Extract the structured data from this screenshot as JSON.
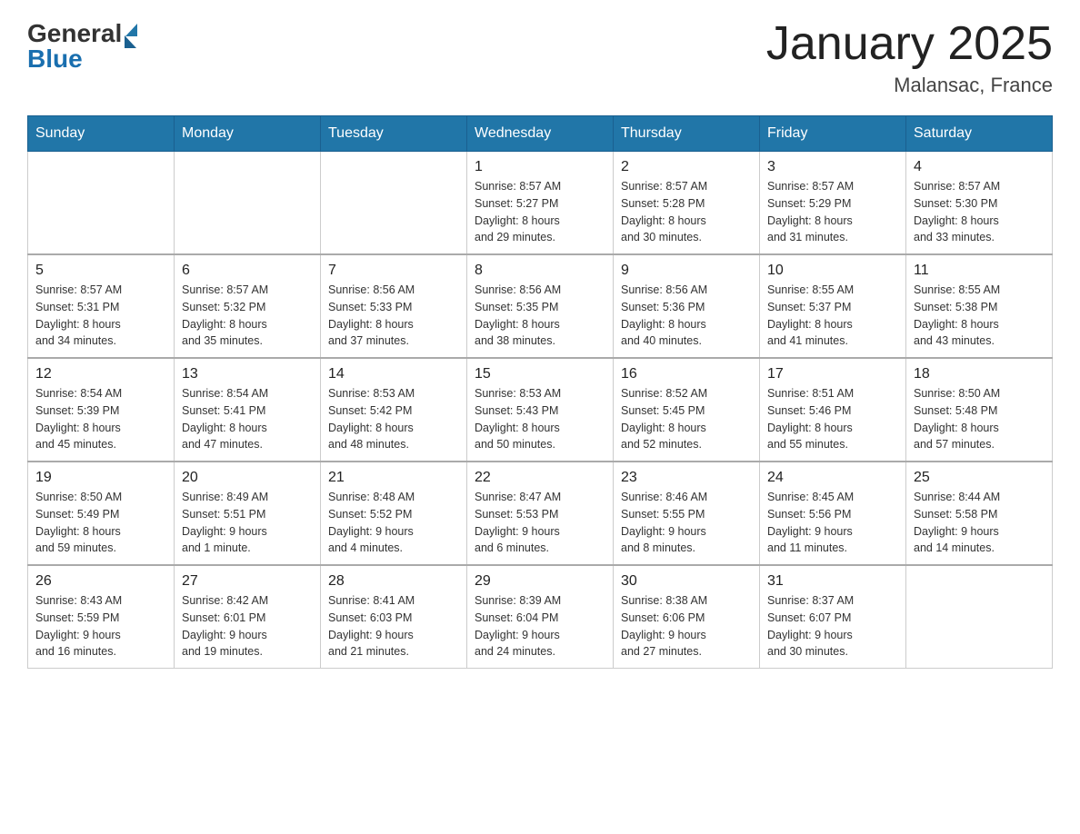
{
  "header": {
    "logo_general": "General",
    "logo_blue": "Blue",
    "title": "January 2025",
    "subtitle": "Malansac, France"
  },
  "days_of_week": [
    "Sunday",
    "Monday",
    "Tuesday",
    "Wednesday",
    "Thursday",
    "Friday",
    "Saturday"
  ],
  "weeks": [
    [
      {
        "day": "",
        "info": ""
      },
      {
        "day": "",
        "info": ""
      },
      {
        "day": "",
        "info": ""
      },
      {
        "day": "1",
        "info": "Sunrise: 8:57 AM\nSunset: 5:27 PM\nDaylight: 8 hours\nand 29 minutes."
      },
      {
        "day": "2",
        "info": "Sunrise: 8:57 AM\nSunset: 5:28 PM\nDaylight: 8 hours\nand 30 minutes."
      },
      {
        "day": "3",
        "info": "Sunrise: 8:57 AM\nSunset: 5:29 PM\nDaylight: 8 hours\nand 31 minutes."
      },
      {
        "day": "4",
        "info": "Sunrise: 8:57 AM\nSunset: 5:30 PM\nDaylight: 8 hours\nand 33 minutes."
      }
    ],
    [
      {
        "day": "5",
        "info": "Sunrise: 8:57 AM\nSunset: 5:31 PM\nDaylight: 8 hours\nand 34 minutes."
      },
      {
        "day": "6",
        "info": "Sunrise: 8:57 AM\nSunset: 5:32 PM\nDaylight: 8 hours\nand 35 minutes."
      },
      {
        "day": "7",
        "info": "Sunrise: 8:56 AM\nSunset: 5:33 PM\nDaylight: 8 hours\nand 37 minutes."
      },
      {
        "day": "8",
        "info": "Sunrise: 8:56 AM\nSunset: 5:35 PM\nDaylight: 8 hours\nand 38 minutes."
      },
      {
        "day": "9",
        "info": "Sunrise: 8:56 AM\nSunset: 5:36 PM\nDaylight: 8 hours\nand 40 minutes."
      },
      {
        "day": "10",
        "info": "Sunrise: 8:55 AM\nSunset: 5:37 PM\nDaylight: 8 hours\nand 41 minutes."
      },
      {
        "day": "11",
        "info": "Sunrise: 8:55 AM\nSunset: 5:38 PM\nDaylight: 8 hours\nand 43 minutes."
      }
    ],
    [
      {
        "day": "12",
        "info": "Sunrise: 8:54 AM\nSunset: 5:39 PM\nDaylight: 8 hours\nand 45 minutes."
      },
      {
        "day": "13",
        "info": "Sunrise: 8:54 AM\nSunset: 5:41 PM\nDaylight: 8 hours\nand 47 minutes."
      },
      {
        "day": "14",
        "info": "Sunrise: 8:53 AM\nSunset: 5:42 PM\nDaylight: 8 hours\nand 48 minutes."
      },
      {
        "day": "15",
        "info": "Sunrise: 8:53 AM\nSunset: 5:43 PM\nDaylight: 8 hours\nand 50 minutes."
      },
      {
        "day": "16",
        "info": "Sunrise: 8:52 AM\nSunset: 5:45 PM\nDaylight: 8 hours\nand 52 minutes."
      },
      {
        "day": "17",
        "info": "Sunrise: 8:51 AM\nSunset: 5:46 PM\nDaylight: 8 hours\nand 55 minutes."
      },
      {
        "day": "18",
        "info": "Sunrise: 8:50 AM\nSunset: 5:48 PM\nDaylight: 8 hours\nand 57 minutes."
      }
    ],
    [
      {
        "day": "19",
        "info": "Sunrise: 8:50 AM\nSunset: 5:49 PM\nDaylight: 8 hours\nand 59 minutes."
      },
      {
        "day": "20",
        "info": "Sunrise: 8:49 AM\nSunset: 5:51 PM\nDaylight: 9 hours\nand 1 minute."
      },
      {
        "day": "21",
        "info": "Sunrise: 8:48 AM\nSunset: 5:52 PM\nDaylight: 9 hours\nand 4 minutes."
      },
      {
        "day": "22",
        "info": "Sunrise: 8:47 AM\nSunset: 5:53 PM\nDaylight: 9 hours\nand 6 minutes."
      },
      {
        "day": "23",
        "info": "Sunrise: 8:46 AM\nSunset: 5:55 PM\nDaylight: 9 hours\nand 8 minutes."
      },
      {
        "day": "24",
        "info": "Sunrise: 8:45 AM\nSunset: 5:56 PM\nDaylight: 9 hours\nand 11 minutes."
      },
      {
        "day": "25",
        "info": "Sunrise: 8:44 AM\nSunset: 5:58 PM\nDaylight: 9 hours\nand 14 minutes."
      }
    ],
    [
      {
        "day": "26",
        "info": "Sunrise: 8:43 AM\nSunset: 5:59 PM\nDaylight: 9 hours\nand 16 minutes."
      },
      {
        "day": "27",
        "info": "Sunrise: 8:42 AM\nSunset: 6:01 PM\nDaylight: 9 hours\nand 19 minutes."
      },
      {
        "day": "28",
        "info": "Sunrise: 8:41 AM\nSunset: 6:03 PM\nDaylight: 9 hours\nand 21 minutes."
      },
      {
        "day": "29",
        "info": "Sunrise: 8:39 AM\nSunset: 6:04 PM\nDaylight: 9 hours\nand 24 minutes."
      },
      {
        "day": "30",
        "info": "Sunrise: 8:38 AM\nSunset: 6:06 PM\nDaylight: 9 hours\nand 27 minutes."
      },
      {
        "day": "31",
        "info": "Sunrise: 8:37 AM\nSunset: 6:07 PM\nDaylight: 9 hours\nand 30 minutes."
      },
      {
        "day": "",
        "info": ""
      }
    ]
  ]
}
